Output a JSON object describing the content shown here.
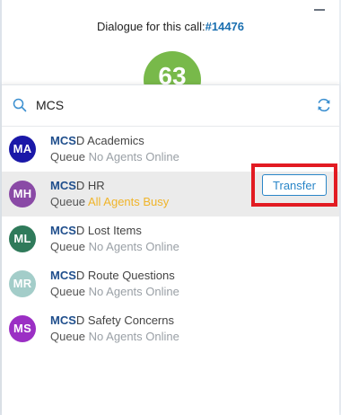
{
  "header": {
    "dialogue_label": "Dialogue for this call:",
    "call_number": "#14476",
    "score": "63"
  },
  "search": {
    "query": "MCS",
    "icon": "search-icon",
    "refresh_icon": "refresh-icon"
  },
  "queues": [
    {
      "initials": "MA",
      "match": "MCS",
      "rest": "D Academics",
      "queue_label": "Queue",
      "status": "No Agents Online",
      "status_type": "offline",
      "avatar_color": "#1a18a8"
    },
    {
      "initials": "MH",
      "match": "MCS",
      "rest": "D HR",
      "queue_label": "Queue",
      "status": "All Agents Busy",
      "status_type": "busy",
      "avatar_color": "#8a4aa6",
      "action_label": "Transfer"
    },
    {
      "initials": "ML",
      "match": "MCS",
      "rest": "D Lost Items",
      "queue_label": "Queue",
      "status": "No Agents Online",
      "status_type": "offline",
      "avatar_color": "#2f7a5a"
    },
    {
      "initials": "MR",
      "match": "MCS",
      "rest": "D Route Questions",
      "queue_label": "Queue",
      "status": "No Agents Online",
      "status_type": "offline",
      "avatar_color": "#a3cdc9"
    },
    {
      "initials": "MS",
      "match": "MCS",
      "rest": "D Safety Concerns",
      "queue_label": "Queue",
      "status": "No Agents Online",
      "status_type": "offline",
      "avatar_color": "#9b2fc4"
    }
  ],
  "colors": {
    "accent": "#2a86c8",
    "score_green": "#78b94a",
    "busy": "#f0b429",
    "highlight_box": "#e21b22"
  }
}
